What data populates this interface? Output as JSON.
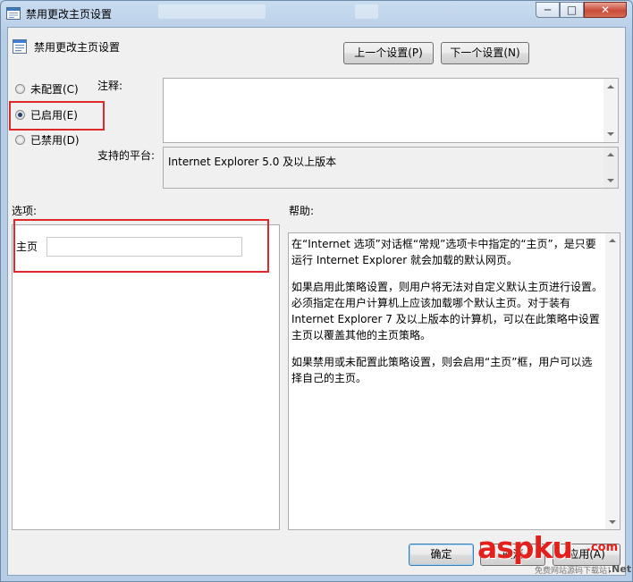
{
  "window": {
    "title": "禁用更改主页设置"
  },
  "caption": {
    "minimize": "─",
    "maximize": "□",
    "close": "✕"
  },
  "header": {
    "setting_name": "禁用更改主页设置",
    "prev_button": "上一个设置(P)",
    "next_button": "下一个设置(N)"
  },
  "state": {
    "options": [
      {
        "label": "未配置(C)",
        "checked": false
      },
      {
        "label": "已启用(E)",
        "checked": true
      },
      {
        "label": "已禁用(D)",
        "checked": false
      }
    ]
  },
  "comment": {
    "label": "注释:",
    "value": ""
  },
  "platform": {
    "label": "支持的平台:",
    "value": "Internet Explorer 5.0 及以上版本"
  },
  "options_section": {
    "label": "选项:",
    "homepage_label": "主页",
    "homepage_value": ""
  },
  "help_section": {
    "label": "帮助:",
    "paragraphs": [
      "在“Internet 选项”对话框“常规”选项卡中指定的“主页”，是只要运行 Internet Explorer 就会加载的默认网页。",
      "如果启用此策略设置，则用户将无法对自定义默认主页进行设置。必须指定在用户计算机上应该加载哪个默认主页。对于装有 Internet Explorer 7 及以上版本的计算机，可以在此策略中设置主页以覆盖其他的主页策略。",
      "如果禁用或未配置此策略设置，则会启用“主页”框，用户可以选择自己的主页。"
    ]
  },
  "footer": {
    "ok_button": "确定",
    "cancel_button": "取消",
    "apply_button": "应用(A)"
  },
  "watermark": {
    "brand": "aspku",
    "suffix": ".com",
    "tagline": "免费网站源码下载站！",
    "net": ".Net"
  }
}
